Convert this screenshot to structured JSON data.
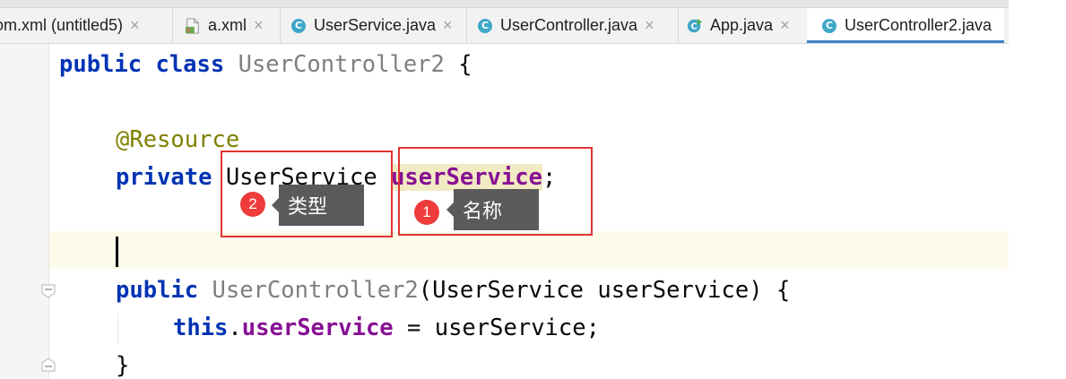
{
  "tabs": [
    {
      "label": "om.xml (untitled5)",
      "icon": "none",
      "active": false
    },
    {
      "label": "a.xml",
      "icon": "xml-file-icon",
      "active": false
    },
    {
      "label": "UserService.java",
      "icon": "java-class-icon",
      "active": false
    },
    {
      "label": "UserController.java",
      "icon": "java-class-icon",
      "active": false
    },
    {
      "label": "App.java",
      "icon": "java-runnable-class-icon",
      "active": false
    },
    {
      "label": "UserController2.java",
      "icon": "java-class-icon",
      "active": true
    }
  ],
  "tab_close_glyph": "×",
  "code": {
    "l1_kw": "public class",
    "l1_cls": "UserController2",
    "l1_brace": " {",
    "l2_ann": "@Resource",
    "l3_kw": "private",
    "l3_type": "UserService",
    "l3_field": "userService",
    "l3_semi": ";",
    "l4_kw": "public",
    "l4_cls": "UserController2",
    "l4_rest": "(UserService userService) {",
    "l5_kw": "this",
    "l5_dot": ".",
    "l5_field": "userService",
    "l5_rest": " = userService;",
    "l6_brace": "}"
  },
  "annotations": [
    {
      "number": "2",
      "label": "类型"
    },
    {
      "number": "1",
      "label": "名称"
    }
  ],
  "colors": {
    "keyword": "#0033b3",
    "field": "#871094",
    "annotation": "#808000",
    "highlight_box": "#e03333",
    "active_tab_underline": "#4083c9"
  }
}
